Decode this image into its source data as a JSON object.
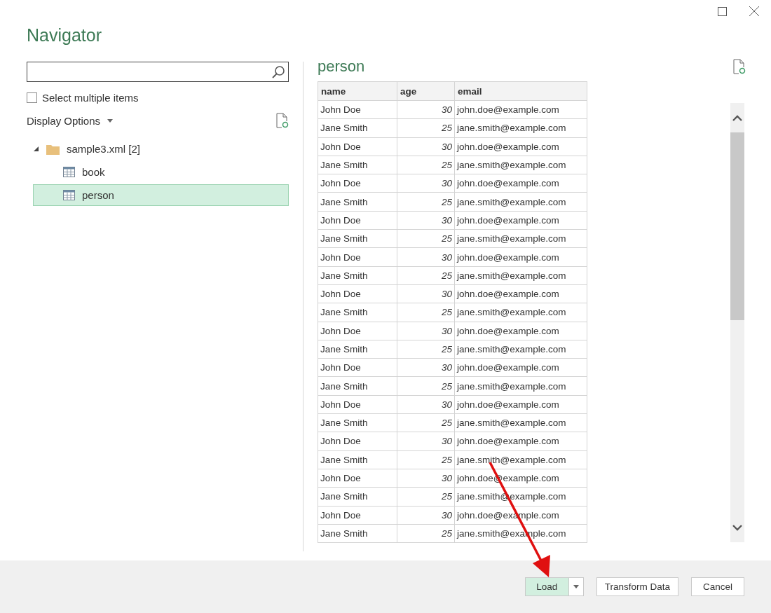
{
  "window": {
    "title": "Navigator"
  },
  "select_multiple": {
    "label": "Select multiple items",
    "checked": false
  },
  "display_options": {
    "label": "Display Options"
  },
  "tree": [
    {
      "label": "sample3.xml [2]",
      "kind": "folder",
      "expanded": true,
      "children": [
        {
          "label": "book",
          "kind": "table",
          "selected": false
        },
        {
          "label": "person",
          "kind": "table",
          "selected": true
        }
      ]
    }
  ],
  "preview": {
    "title": "person",
    "columns": [
      {
        "label": "name",
        "kind": "text"
      },
      {
        "label": "age",
        "kind": "number"
      },
      {
        "label": "email",
        "kind": "text"
      }
    ],
    "rows": [
      [
        "John Doe",
        "30",
        "john.doe@example.com"
      ],
      [
        "Jane Smith",
        "25",
        "jane.smith@example.com"
      ],
      [
        "John Doe",
        "30",
        "john.doe@example.com"
      ],
      [
        "Jane Smith",
        "25",
        "jane.smith@example.com"
      ],
      [
        "John Doe",
        "30",
        "john.doe@example.com"
      ],
      [
        "Jane Smith",
        "25",
        "jane.smith@example.com"
      ],
      [
        "John Doe",
        "30",
        "john.doe@example.com"
      ],
      [
        "Jane Smith",
        "25",
        "jane.smith@example.com"
      ],
      [
        "John Doe",
        "30",
        "john.doe@example.com"
      ],
      [
        "Jane Smith",
        "25",
        "jane.smith@example.com"
      ],
      [
        "John Doe",
        "30",
        "john.doe@example.com"
      ],
      [
        "Jane Smith",
        "25",
        "jane.smith@example.com"
      ],
      [
        "John Doe",
        "30",
        "john.doe@example.com"
      ],
      [
        "Jane Smith",
        "25",
        "jane.smith@example.com"
      ],
      [
        "John Doe",
        "30",
        "john.doe@example.com"
      ],
      [
        "Jane Smith",
        "25",
        "jane.smith@example.com"
      ],
      [
        "John Doe",
        "30",
        "john.doe@example.com"
      ],
      [
        "Jane Smith",
        "25",
        "jane.smith@example.com"
      ],
      [
        "John Doe",
        "30",
        "john.doe@example.com"
      ],
      [
        "Jane Smith",
        "25",
        "jane.smith@example.com"
      ],
      [
        "John Doe",
        "30",
        "john.doe@example.com"
      ],
      [
        "Jane Smith",
        "25",
        "jane.smith@example.com"
      ],
      [
        "John Doe",
        "30",
        "john.doe@example.com"
      ],
      [
        "Jane Smith",
        "25",
        "jane.smith@example.com"
      ]
    ]
  },
  "buttons": [
    {
      "label": "Load",
      "kind": "split"
    },
    {
      "label": "Transform Data",
      "kind": "plain"
    },
    {
      "label": "Cancel",
      "kind": "plain"
    }
  ]
}
